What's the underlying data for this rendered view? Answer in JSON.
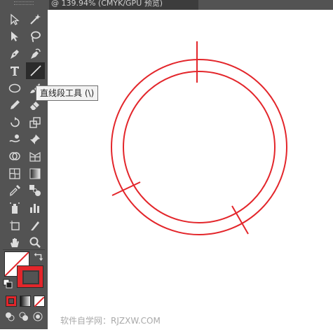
{
  "document": {
    "tab_title": "@ 139.94% (CMYK/GPU 预览)"
  },
  "tooltip": {
    "text": "直线段工具 (\\)"
  },
  "watermark": {
    "text": "软件自学网：RJZXW.COM"
  },
  "colors": {
    "stroke": "#e3262b",
    "panel": "#535353",
    "canvas": "#ffffff"
  },
  "tools": [
    "direct-selection-tool",
    "magic-wand-tool",
    "selection-tool",
    "lasso-tool",
    "pen-tool",
    "curvature-tool",
    "type-tool",
    "line-segment-tool",
    "ellipse-tool",
    "paintbrush-tool",
    "pencil-tool",
    "eraser-tool",
    "rotate-tool",
    "scale-tool",
    "warp-tool",
    "pin-tool",
    "shape-builder-tool",
    "perspective-grid-tool",
    "mesh-tool",
    "gradient-tool",
    "eyedropper-tool",
    "blend-tool",
    "symbol-sprayer-tool",
    "column-graph-tool",
    "artboard-tool",
    "slice-tool",
    "hand-tool",
    "zoom-tool"
  ]
}
